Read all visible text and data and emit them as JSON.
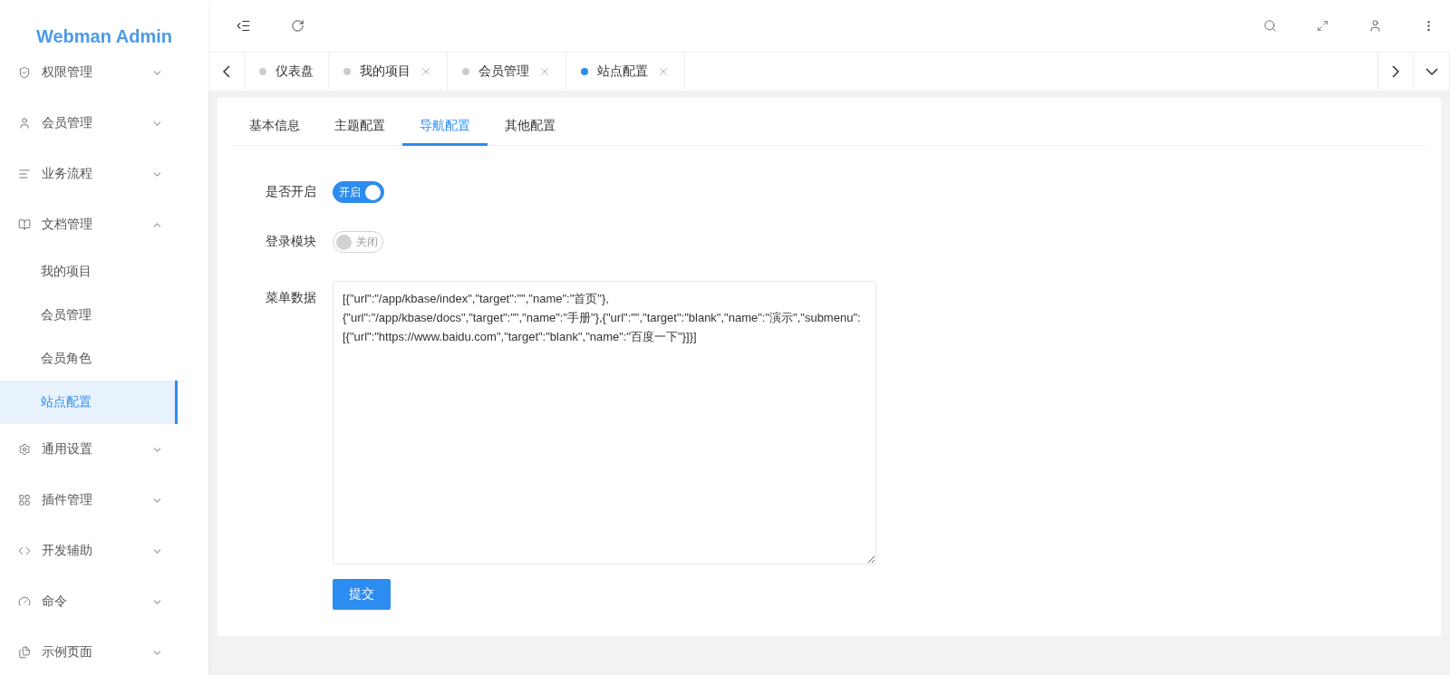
{
  "sidebar": {
    "logo": "Webman Admin",
    "items": [
      {
        "label": "权限管理",
        "expanded": false
      },
      {
        "label": "会员管理",
        "expanded": false
      },
      {
        "label": "业务流程",
        "expanded": false
      },
      {
        "label": "文档管理",
        "expanded": true,
        "children": [
          {
            "label": "我的项目",
            "selected": false
          },
          {
            "label": "会员管理",
            "selected": false
          },
          {
            "label": "会员角色",
            "selected": false
          },
          {
            "label": "站点配置",
            "selected": true
          }
        ]
      },
      {
        "label": "通用设置",
        "expanded": false
      },
      {
        "label": "插件管理",
        "expanded": false
      },
      {
        "label": "开发辅助",
        "expanded": false
      },
      {
        "label": "命令",
        "expanded": false
      },
      {
        "label": "示例页面",
        "expanded": false
      }
    ]
  },
  "page_tabs": [
    {
      "label": "仪表盘",
      "selected": false,
      "closable": false
    },
    {
      "label": "我的项目",
      "selected": false,
      "closable": true
    },
    {
      "label": "会员管理",
      "selected": false,
      "closable": true
    },
    {
      "label": "站点配置",
      "selected": true,
      "closable": true
    }
  ],
  "config_tabs": [
    {
      "label": "基本信息",
      "selected": false
    },
    {
      "label": "主题配置",
      "selected": false
    },
    {
      "label": "导航配置",
      "selected": true
    },
    {
      "label": "其他配置",
      "selected": false
    }
  ],
  "form": {
    "fields": [
      {
        "kind": "switch",
        "label": "是否开启",
        "on": true,
        "text": "开启"
      },
      {
        "kind": "switch",
        "label": "登录模块",
        "on": false,
        "text": "关闭"
      },
      {
        "kind": "textarea",
        "label": "菜单数据",
        "value": "[{\"url\":\"/app/kbase/index\",\"target\":\"\",\"name\":\"首页\"},{\"url\":\"/app/kbase/docs\",\"target\":\"\",\"name\":\"手册\"},{\"url\":\"\",\"target\":\"blank\",\"name\":\"演示\",\"submenu\":[{\"url\":\"https://www.baidu.com\",\"target\":\"blank\",\"name\":\"百度一下\"}]}]"
      }
    ],
    "submit": "提交"
  }
}
